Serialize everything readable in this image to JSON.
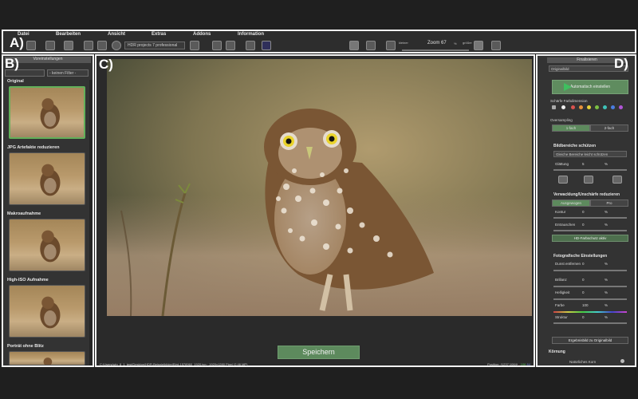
{
  "callouts": {
    "a": "A)",
    "b": "B)",
    "c": "C)",
    "d": "D)"
  },
  "menu": [
    "Datei",
    "Bearbeiten",
    "Ansicht",
    "Extras",
    "Addons",
    "Information"
  ],
  "toolbar": {
    "project_select": "HDR projects 7 professional",
    "zoom_label": "Zoom 67",
    "zoom_small": "kleiner",
    "zoom_large": "größer",
    "percent": "%"
  },
  "left_panel": {
    "header": "Voreinstellungen",
    "filter_value": "- keinen Filter -",
    "presets": [
      "Original",
      "JPG Artefakte reduzieren",
      "Makroaufnahme",
      "High-ISO Aufnahme",
      "Porträt ohne Blitz"
    ]
  },
  "main": {
    "save_label": "Speichern",
    "status_path": "C:/Users/win_8_1_test/Desktop/HDR-Beispielbilder/Bird-1578960_1920.jpg · 1920x1280 Pixel (2,46 MP)",
    "status_right_label": "Position:",
    "status_coords": "(1237,1084)",
    "status_r": "-",
    "status_g": "106",
    "status_b": "84"
  },
  "right_panel": {
    "header": "Finalisieren",
    "original_box": "Originalbild",
    "auto_button": "Automatisch einstellen",
    "color_profile_label": "Schärfe Farbdimension",
    "oversampling_label": "Oversampling",
    "oversampling_options": [
      "1-fach",
      "2-fach"
    ],
    "protect_label": "Bildbereiche schützen",
    "protect_select": "Gleiche Bereiche leicht schützen",
    "smoothing_label": "Glättung",
    "smoothing_value": "5",
    "noise_label": "Verwacklung/Unschärfe reduzieren",
    "noise_tabs": [
      "Ausgewogen",
      "Pro"
    ],
    "contour_label": "Kontur",
    "contour_value": "0",
    "denoise_label": "Entrauschen",
    "denoise_value": "0",
    "hd_button": "HD-Farbschutz aktiv",
    "photo_label": "Fotografische Einstellungen",
    "rows": [
      {
        "label": "Dunst entfernen",
        "value": "0"
      },
      {
        "label": "Brillanz",
        "value": "0"
      },
      {
        "label": "Helligkeit",
        "value": "0"
      },
      {
        "label": "Farbe",
        "value": "100"
      },
      {
        "label": "Struktur",
        "value": "0"
      }
    ],
    "compare_button": "Ergebnisbild zu Originalbild",
    "grain_label": "Körnung",
    "grain_value": "Natürliches Korn",
    "unit": "%"
  },
  "colors": {
    "accent_green": "#5d8a5d",
    "frame_white": "#f2f2f2",
    "selected_border": "#63b05a"
  }
}
